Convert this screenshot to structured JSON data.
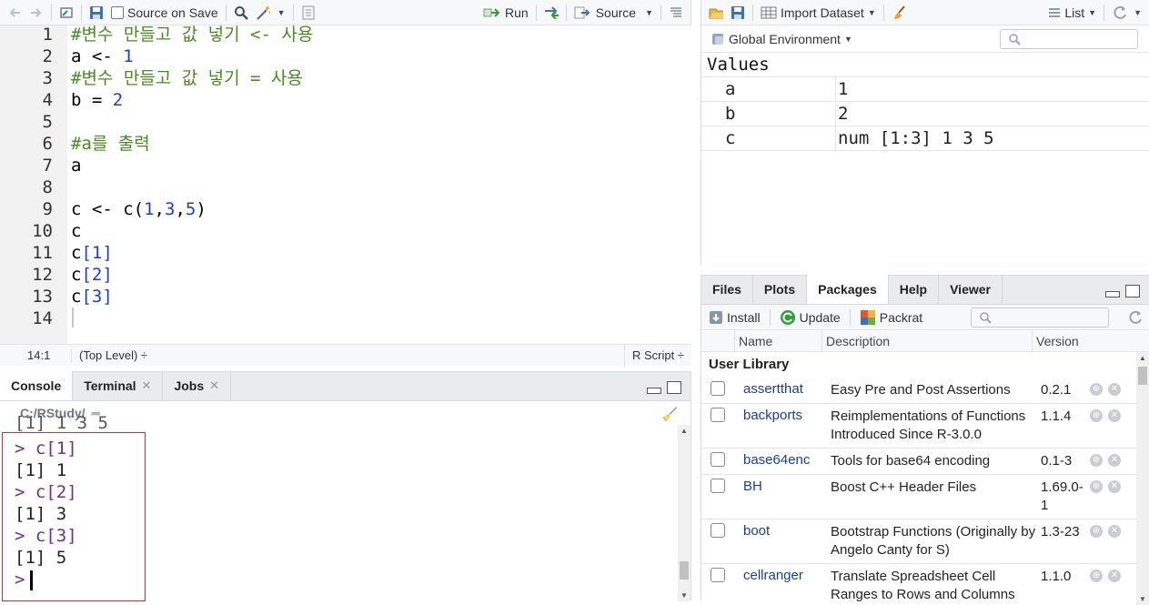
{
  "editor": {
    "toolbar": {
      "source_on_save": "Source on Save",
      "run": "Run",
      "source": "Source"
    },
    "lines": [
      {
        "n": "1",
        "parts": [
          {
            "t": "#변수 만들고 값 넣기 <- 사용",
            "c": "cm"
          }
        ]
      },
      {
        "n": "2",
        "parts": [
          {
            "t": "a <- ",
            "c": ""
          },
          {
            "t": "1",
            "c": "num"
          }
        ]
      },
      {
        "n": "3",
        "parts": [
          {
            "t": "#변수 만들고 값 넣기 = 사용",
            "c": "cm"
          }
        ]
      },
      {
        "n": "4",
        "parts": [
          {
            "t": "b = ",
            "c": ""
          },
          {
            "t": "2",
            "c": "num"
          }
        ]
      },
      {
        "n": "5",
        "parts": []
      },
      {
        "n": "6",
        "parts": [
          {
            "t": "#a를 출력",
            "c": "cm"
          }
        ]
      },
      {
        "n": "7",
        "parts": [
          {
            "t": "a",
            "c": ""
          }
        ]
      },
      {
        "n": "8",
        "parts": []
      },
      {
        "n": "9",
        "parts": [
          {
            "t": "c <- c(",
            "c": ""
          },
          {
            "t": "1",
            "c": "num"
          },
          {
            "t": ",",
            "c": ""
          },
          {
            "t": "3",
            "c": "num"
          },
          {
            "t": ",",
            "c": ""
          },
          {
            "t": "5",
            "c": "num"
          },
          {
            "t": ")",
            "c": ""
          }
        ]
      },
      {
        "n": "10",
        "parts": [
          {
            "t": "c",
            "c": ""
          }
        ]
      },
      {
        "n": "11",
        "parts": [
          {
            "t": "c",
            "c": ""
          },
          {
            "t": "[1]",
            "c": "br"
          }
        ]
      },
      {
        "n": "12",
        "parts": [
          {
            "t": "c",
            "c": ""
          },
          {
            "t": "[2]",
            "c": "br"
          }
        ]
      },
      {
        "n": "13",
        "parts": [
          {
            "t": "c",
            "c": ""
          },
          {
            "t": "[3]",
            "c": "br"
          }
        ]
      },
      {
        "n": "14",
        "parts": []
      }
    ],
    "status": {
      "position": "14:1",
      "scope": "(Top Level) ÷",
      "file_type": "R Script ÷"
    }
  },
  "console": {
    "tabs": [
      {
        "label": "Console",
        "closable": false
      },
      {
        "label": "Terminal",
        "closable": true
      },
      {
        "label": "Jobs",
        "closable": true
      }
    ],
    "path": "C:/RStudy/",
    "lines": [
      {
        "text": "> c[1]",
        "prompt": true
      },
      {
        "text": "[1] 1",
        "prompt": false
      },
      {
        "text": "> c[2]",
        "prompt": true
      },
      {
        "text": "[1] 3",
        "prompt": false
      },
      {
        "text": "> c[3]",
        "prompt": true
      },
      {
        "text": "[1] 5",
        "prompt": false
      },
      {
        "text": ">",
        "prompt": true
      }
    ]
  },
  "environment": {
    "toolbar": {
      "import_dataset": "Import Dataset",
      "view_mode": "List"
    },
    "scope": "Global Environment",
    "section": "Values",
    "rows": [
      {
        "name": "a",
        "value": "1"
      },
      {
        "name": "b",
        "value": "2"
      },
      {
        "name": "c",
        "value": "num [1:3] 1 3 5"
      }
    ]
  },
  "packages_pane": {
    "tabs": [
      "Files",
      "Plots",
      "Packages",
      "Help",
      "Viewer"
    ],
    "active_tab": "Packages",
    "toolbar": {
      "install": "Install",
      "update": "Update",
      "packrat": "Packrat"
    },
    "columns": {
      "name": "Name",
      "description": "Description",
      "version": "Version"
    },
    "section": "User Library",
    "rows": [
      {
        "name": "assertthat",
        "description": "Easy Pre and Post Assertions",
        "version": "0.2.1"
      },
      {
        "name": "backports",
        "description": "Reimplementations of Functions Introduced Since R-3.0.0",
        "version": "1.1.4"
      },
      {
        "name": "base64enc",
        "description": "Tools for base64 encoding",
        "version": "0.1-3"
      },
      {
        "name": "BH",
        "description": "Boost C++ Header Files",
        "version": "1.69.0-1"
      },
      {
        "name": "boot",
        "description": "Bootstrap Functions (Originally by Angelo Canty for S)",
        "version": "1.3-23"
      },
      {
        "name": "cellranger",
        "description": "Translate Spreadsheet Cell Ranges to Rows and Columns",
        "version": "1.1.0"
      }
    ]
  }
}
